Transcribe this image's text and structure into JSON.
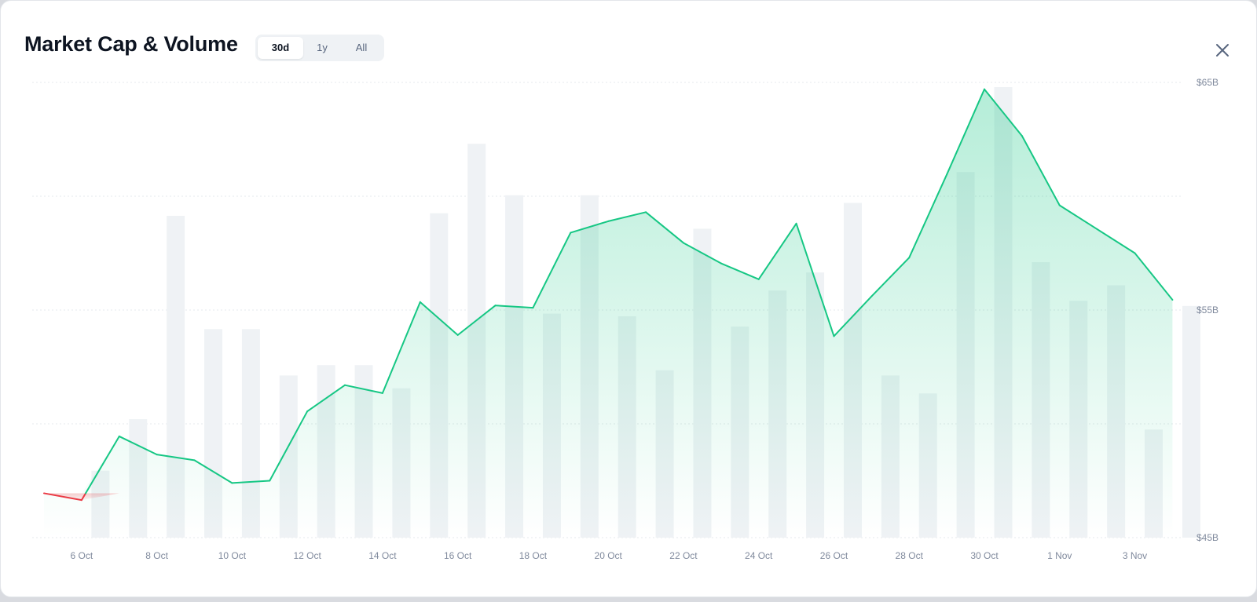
{
  "header": {
    "title": "Market Cap & Volume",
    "tabs": [
      {
        "label": "30d",
        "active": true
      },
      {
        "label": "1y",
        "active": false
      },
      {
        "label": "All",
        "active": false
      }
    ],
    "close_icon": "close-icon"
  },
  "colors": {
    "up": "#16c784",
    "down": "#ea3943",
    "volume_bar": "#eff2f5",
    "grid": "#e6e8ec",
    "axis_text": "#808a9d"
  },
  "chart_data": {
    "type": "line",
    "title": "Market Cap & Volume",
    "xlabel": "",
    "ylabel": "",
    "x": [
      "5 Oct",
      "6 Oct",
      "7 Oct",
      "8 Oct",
      "9 Oct",
      "10 Oct",
      "11 Oct",
      "12 Oct",
      "13 Oct",
      "14 Oct",
      "15 Oct",
      "16 Oct",
      "17 Oct",
      "18 Oct",
      "19 Oct",
      "20 Oct",
      "21 Oct",
      "22 Oct",
      "23 Oct",
      "24 Oct",
      "25 Oct",
      "26 Oct",
      "27 Oct",
      "28 Oct",
      "29 Oct",
      "30 Oct",
      "31 Oct",
      "1 Nov",
      "2 Nov",
      "3 Nov",
      "4 Nov"
    ],
    "x_tick_labels": [
      "6 Oct",
      "8 Oct",
      "10 Oct",
      "12 Oct",
      "14 Oct",
      "16 Oct",
      "18 Oct",
      "20 Oct",
      "22 Oct",
      "24 Oct",
      "26 Oct",
      "28 Oct",
      "30 Oct",
      "1 Nov",
      "3 Nov"
    ],
    "series": [
      {
        "values": [
          46.95,
          46.65,
          49.45,
          48.65,
          48.4,
          47.4,
          47.5,
          50.55,
          51.7,
          51.35,
          55.35,
          53.9,
          55.2,
          55.1,
          58.4,
          58.9,
          59.3,
          57.95,
          57.05,
          56.35,
          58.8,
          53.85,
          55.6,
          57.3,
          60.95,
          64.7,
          62.65,
          59.6,
          58.55,
          57.5,
          55.45
        ]
      }
    ],
    "volume_relative": [
      0,
      0.026,
      0.046,
      0.125,
      0.081,
      0.081,
      0.063,
      0.067,
      0.067,
      0.058,
      0.126,
      0.153,
      0.133,
      0.087,
      0.133,
      0.086,
      0.065,
      0.12,
      0.082,
      0.096,
      0.103,
      0.13,
      0.063,
      0.056,
      0.142,
      0.175,
      0.107,
      0.092,
      0.098,
      0.042,
      0.09
    ],
    "y_ticks": [
      "$45B",
      "$55B",
      "$65B"
    ],
    "ylim": [
      45,
      65
    ],
    "grid": true,
    "baseline_value": 46.95
  }
}
